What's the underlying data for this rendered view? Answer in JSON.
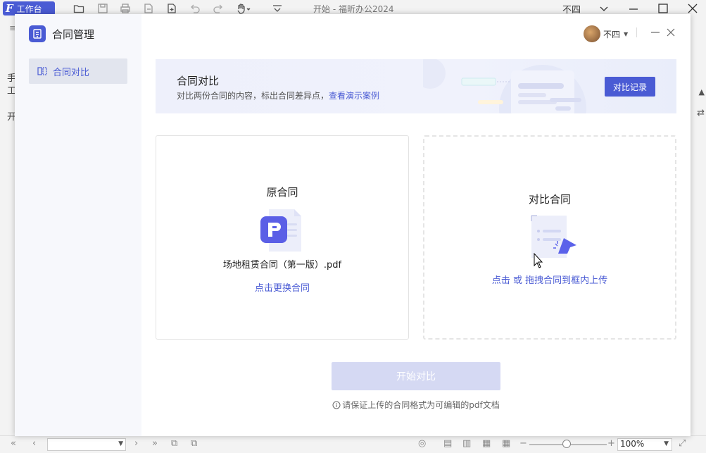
{
  "app": {
    "workbench_label": "工作台",
    "title": "开始 - 福昕办公2024",
    "user_name": "不四",
    "left_peek": [
      "手",
      "工",
      "开"
    ],
    "zoom": "100%"
  },
  "dialog": {
    "sidebar_title": "合同管理",
    "sidebar_items": [
      {
        "label": "合同对比"
      }
    ],
    "user_name": "不四"
  },
  "banner": {
    "title": "合同对比",
    "desc": "对比两份合同的内容，标出合同差异点，",
    "demo_link": "查看演示案例",
    "record_button": "对比记录"
  },
  "original": {
    "title": "原合同",
    "file_name": "场地租赁合同（第一版）.pdf",
    "replace_link": "点击更换合同"
  },
  "compare": {
    "title": "对比合同",
    "upload_hint": "点击 或 拖拽合同到框内上传"
  },
  "actions": {
    "start_button": "开始对比",
    "note": "请保证上传的合同格式为可编辑的pdf文档"
  },
  "colors": {
    "accent": "#4a5bd4",
    "disabled_button": "#d5d9f3"
  }
}
